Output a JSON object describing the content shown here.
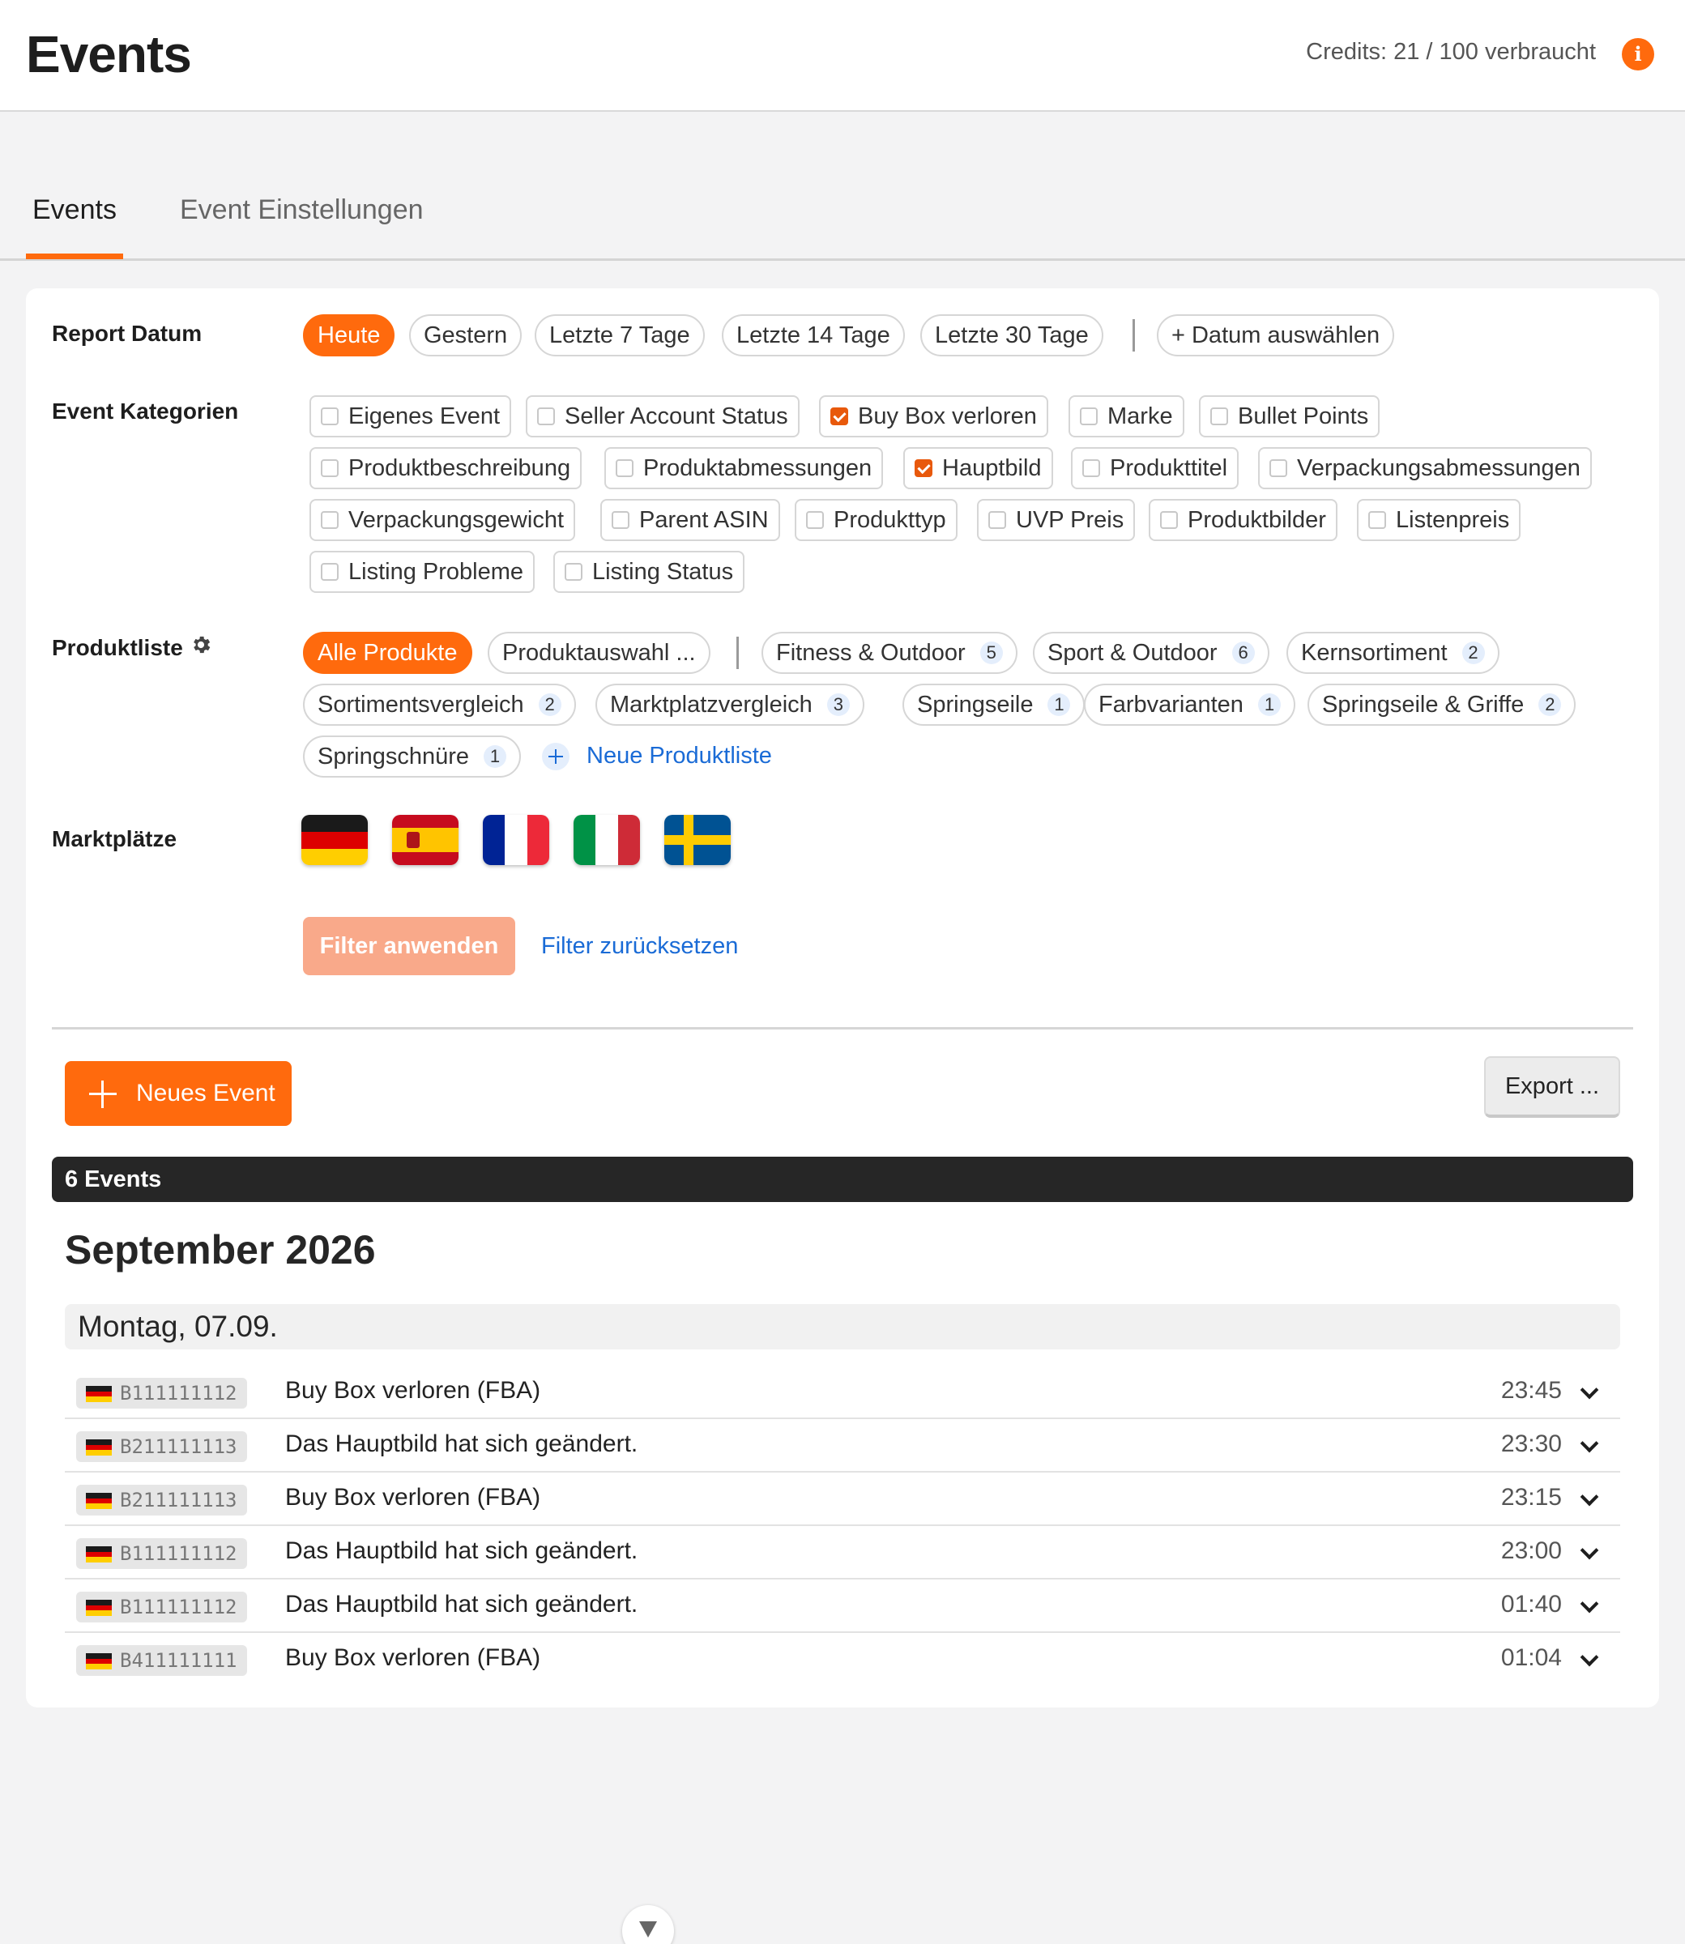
{
  "header": {
    "title": "Events",
    "credits": "Credits: 21 / 100 verbraucht",
    "info_glyph": "i"
  },
  "tabs": [
    {
      "label": "Events",
      "active": true
    },
    {
      "label": "Event Einstellungen",
      "active": false
    }
  ],
  "filters": {
    "report_date": {
      "label": "Report Datum",
      "options": [
        "Heute",
        "Gestern",
        "Letzte 7 Tage",
        "Letzte 14 Tage",
        "Letzte 30 Tage"
      ],
      "selected": "Heute",
      "custom": "+ Datum auswählen"
    },
    "categories": {
      "label": "Event Kategorien",
      "items": [
        {
          "label": "Eigenes Event",
          "checked": false
        },
        {
          "label": "Seller Account Status",
          "checked": false
        },
        {
          "label": "Buy Box verloren",
          "checked": true
        },
        {
          "label": "Marke",
          "checked": false
        },
        {
          "label": "Bullet Points",
          "checked": false
        },
        {
          "label": "Produktbeschreibung",
          "checked": false
        },
        {
          "label": "Produktabmessungen",
          "checked": false
        },
        {
          "label": "Hauptbild",
          "checked": true
        },
        {
          "label": "Produkttitel",
          "checked": false
        },
        {
          "label": "Verpackungsabmessungen",
          "checked": false
        },
        {
          "label": "Verpackungsgewicht",
          "checked": false
        },
        {
          "label": "Parent ASIN",
          "checked": false
        },
        {
          "label": "Produkttyp",
          "checked": false
        },
        {
          "label": "UVP Preis",
          "checked": false
        },
        {
          "label": "Produktbilder",
          "checked": false
        },
        {
          "label": "Listenpreis",
          "checked": false
        },
        {
          "label": "Listing Probleme",
          "checked": false
        },
        {
          "label": "Listing Status",
          "checked": false
        }
      ]
    },
    "product_list": {
      "label": "Produktliste",
      "all": "Alle Produkte",
      "selection": "Produktauswahl ...",
      "lists": [
        {
          "name": "Fitness & Outdoor",
          "count": "5"
        },
        {
          "name": "Sport & Outdoor",
          "count": "6"
        },
        {
          "name": "Kernsortiment",
          "count": "2"
        },
        {
          "name": "Sortimentsvergleich",
          "count": "2"
        },
        {
          "name": "Marktplatzvergleich",
          "count": "3"
        },
        {
          "name": "Springseile",
          "count": "1"
        },
        {
          "name": "Farbvarianten",
          "count": "1"
        },
        {
          "name": "Springseile & Griffe",
          "count": "2"
        },
        {
          "name": "Springschnüre",
          "count": "1"
        }
      ],
      "new_list": "Neue Produktliste"
    },
    "marketplaces": {
      "label": "Marktplätze",
      "flags": [
        "flag-de-icon",
        "flag-es-icon",
        "flag-fr-icon",
        "flag-it-icon",
        "flag-se-icon"
      ]
    },
    "apply": "Filter anwenden",
    "reset": "Filter zurücksetzen"
  },
  "actions": {
    "new_event": "Neues Event",
    "export": "Export ..."
  },
  "events": {
    "count_label": "6 Events",
    "month": "September 2026",
    "day": "Montag, 07.09.",
    "rows": [
      {
        "asin": "B111111112",
        "text": "Buy Box verloren (FBA)",
        "time": "23:45"
      },
      {
        "asin": "B211111113",
        "text": "Das Hauptbild hat sich geändert.",
        "time": "23:30"
      },
      {
        "asin": "B211111113",
        "text": "Buy Box verloren (FBA)",
        "time": "23:15"
      },
      {
        "asin": "B111111112",
        "text": "Das Hauptbild hat sich geändert.",
        "time": "23:00"
      },
      {
        "asin": "B111111112",
        "text": "Das Hauptbild hat sich geändert.",
        "time": "01:40"
      },
      {
        "asin": "B411111111",
        "text": "Buy Box verloren (FBA)",
        "time": "01:04"
      }
    ]
  },
  "colors": {
    "accent": "#ff6a0d",
    "link": "#1a6bd6",
    "dark_bar": "#262626"
  }
}
